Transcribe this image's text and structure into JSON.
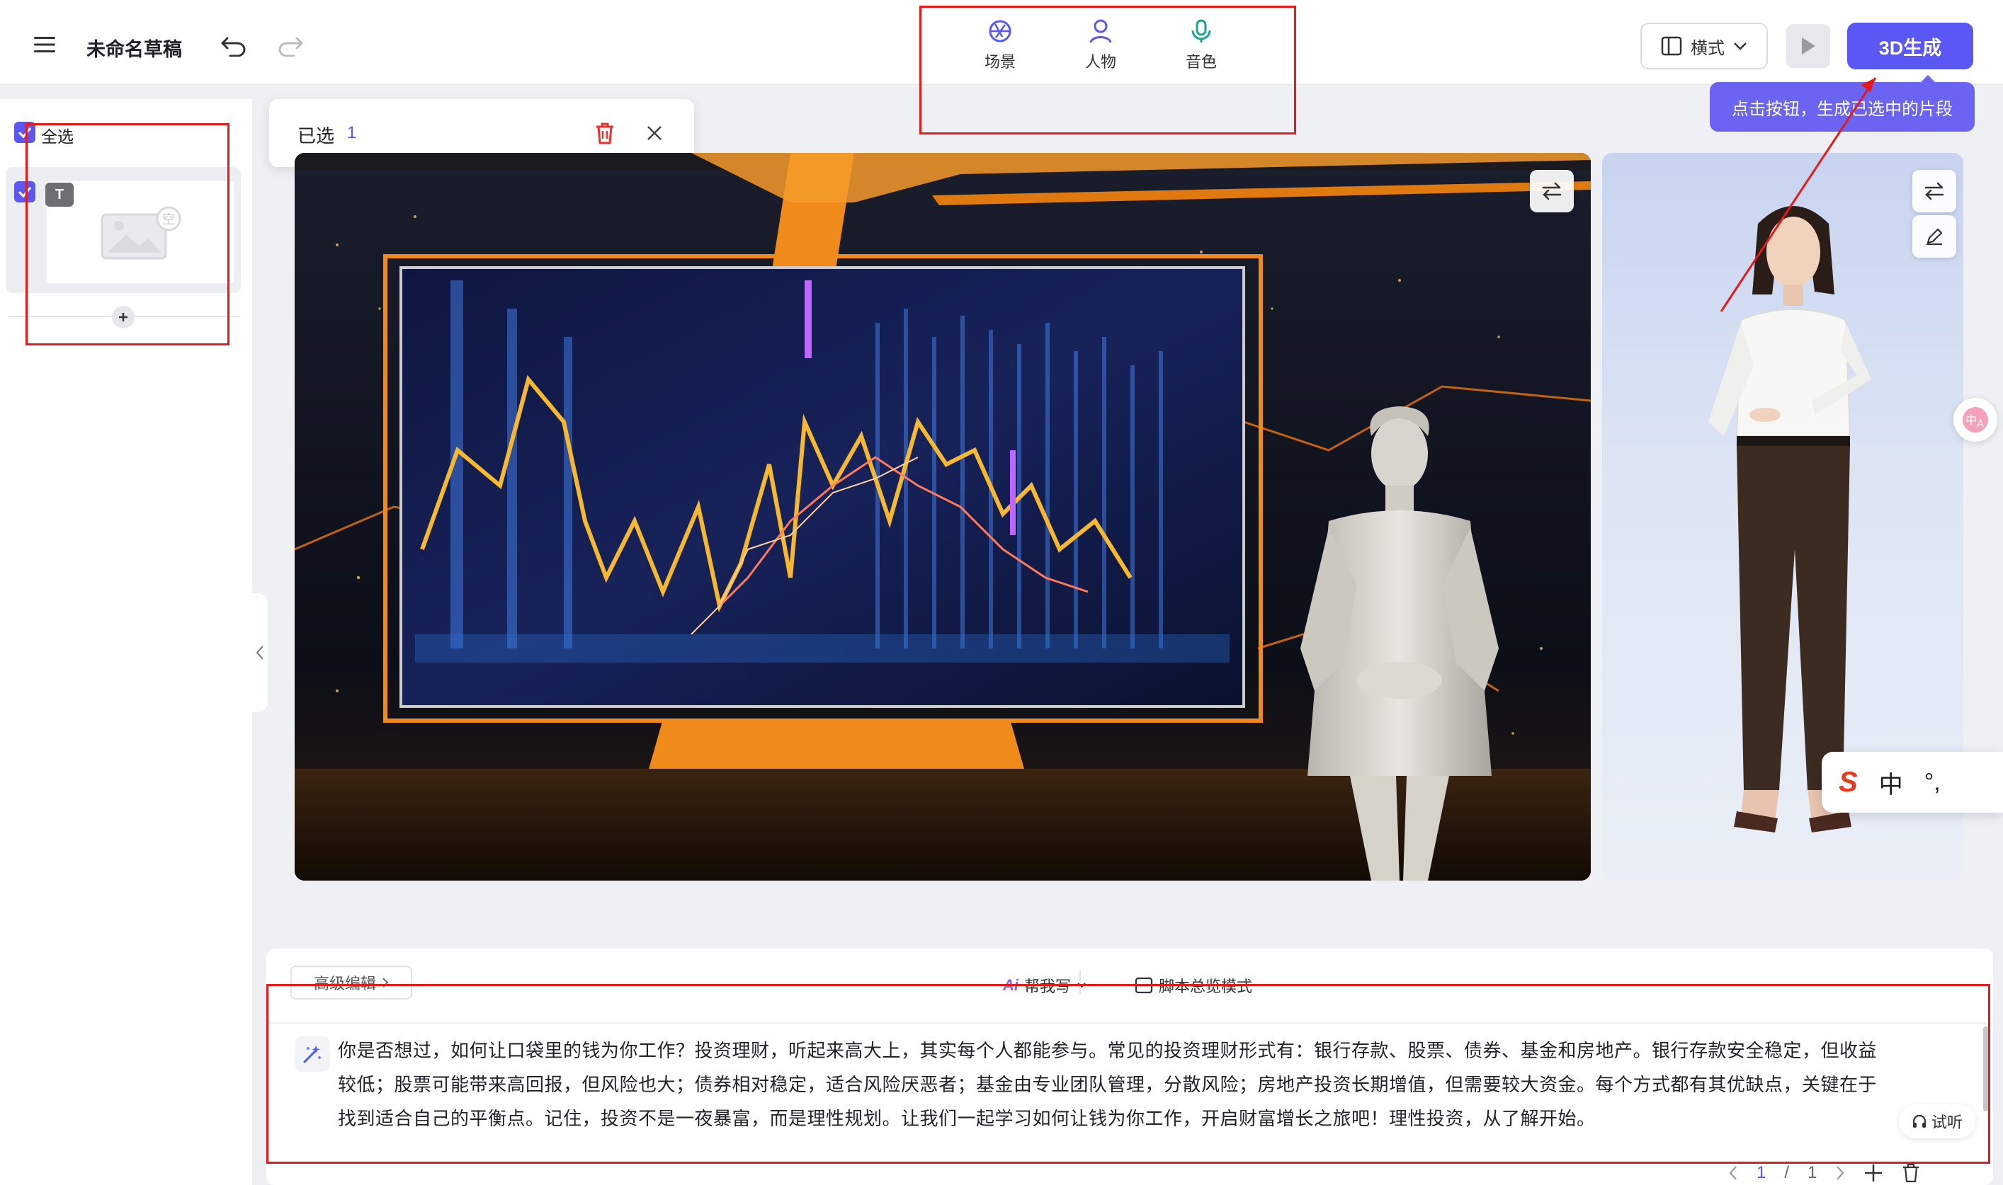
{
  "header": {
    "doc_title": "未命名草稿",
    "tabs": [
      {
        "label": "场景",
        "icon": "scene-icon"
      },
      {
        "label": "人物",
        "icon": "person-icon"
      },
      {
        "label": "音色",
        "icon": "microphone-icon"
      }
    ],
    "mode_label": "横式",
    "generate_label": "3D生成",
    "tooltip": "点击按钮，生成已选中的片段"
  },
  "left_panel": {
    "select_all_label": "全选",
    "segment_badge": "T",
    "thumbnail_placeholder": "空"
  },
  "selection_popup": {
    "label": "已选",
    "count": "1"
  },
  "editor": {
    "advanced_edit_label": "高级编辑",
    "ai_label": "Ai",
    "help_write_label": "帮我写",
    "overview_mode_label": "脚本总览模式",
    "script_text": "你是否想过，如何让口袋里的钱为你工作？投资理财，听起来高大上，其实每个人都能参与。常见的投资理财形式有：银行存款、股票、债券、基金和房地产。银行存款安全稳定，但收益较低；股票可能带来高回报，但风险也大；债券相对稳定，适合风险厌恶者；基金由专业团队管理，分散风险；房地产投资长期增值，但需要较大资金。每个方式都有其优缺点，关键在于找到适合自己的平衡点。记住，投资不是一夜暴富，而是理性规划。让我们一起学习如何让钱为你工作，开启财富增长之旅吧！理性投资，从了解开始。",
    "listen_label": "试听",
    "pager": {
      "current": "1",
      "separator": "/",
      "total": "1"
    }
  },
  "ime_toolbar": {
    "brand": "S",
    "lang": "中",
    "punct": "°,"
  },
  "colors": {
    "accent": "#5b57f5",
    "annotation_red": "#e31b1b",
    "orange": "#f08a1a"
  }
}
